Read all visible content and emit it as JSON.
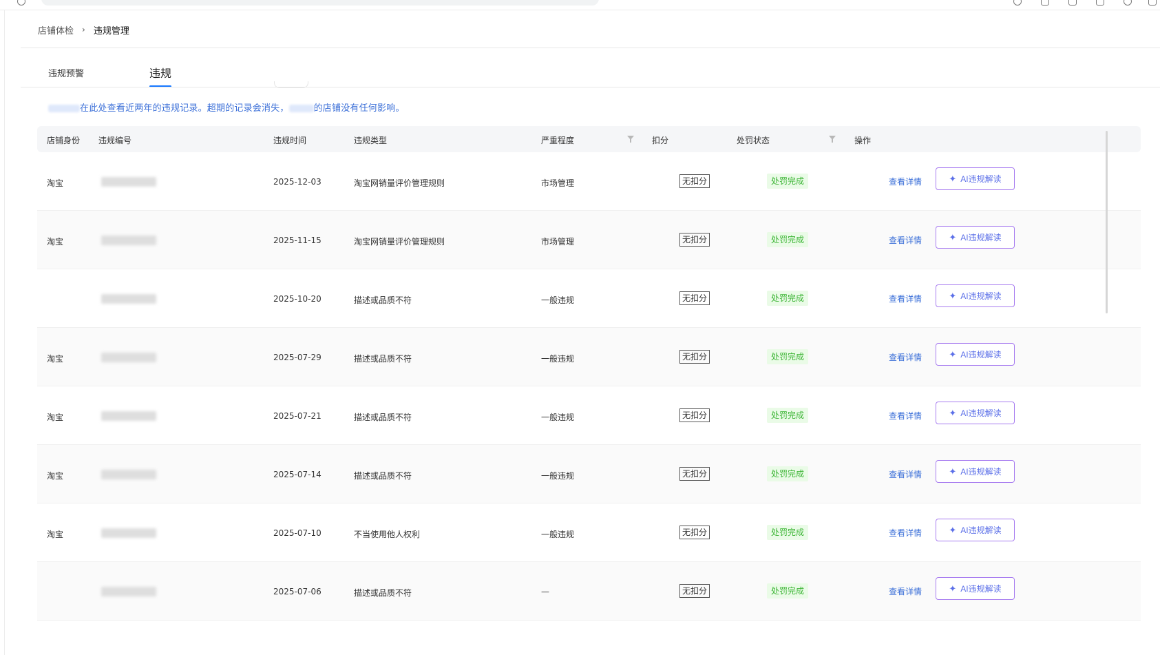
{
  "breadcrumb": {
    "parent": "店铺体检",
    "separator": "›",
    "current": "违规管理"
  },
  "tabs": [
    {
      "label": "违规预警",
      "active": false
    },
    {
      "label": "违规",
      "active": true
    }
  ],
  "notice": {
    "visible_text": "在此处查看近两年的违规记录。超期的记录会消失，",
    "tail_text": "的店铺没有任何影响。"
  },
  "table": {
    "columns": [
      "店铺身份",
      "违规编号",
      "违规时间",
      "违规类型",
      "严重程度",
      "扣分",
      "处罚状态",
      "操作"
    ],
    "rows": [
      {
        "identity": "淘宝",
        "time": "2025-12-03",
        "type": "淘宝网销量评价管理规则",
        "severity": "市场管理",
        "deduct": "无扣分",
        "status": "处罚完成",
        "detail": "查看详情",
        "ai": "AI违规解读"
      },
      {
        "identity": "淘宝",
        "time": "2025-11-15",
        "type": "淘宝网销量评价管理规则",
        "severity": "市场管理",
        "deduct": "无扣分",
        "status": "处罚完成",
        "detail": "查看详情",
        "ai": "AI违规解读"
      },
      {
        "identity": "",
        "time": "2025-10-20",
        "type": "描述或品质不符",
        "severity": "一般违规",
        "deduct": "无扣分",
        "status": "处罚完成",
        "detail": "查看详情",
        "ai": "AI违规解读"
      },
      {
        "identity": "淘宝",
        "time": "2025-07-29",
        "type": "描述或品质不符",
        "severity": "一般违规",
        "deduct": "无扣分",
        "status": "处罚完成",
        "detail": "查看详情",
        "ai": "AI违规解读"
      },
      {
        "identity": "淘宝",
        "time": "2025-07-21",
        "type": "描述或品质不符",
        "severity": "一般违规",
        "deduct": "无扣分",
        "status": "处罚完成",
        "detail": "查看详情",
        "ai": "AI违规解读"
      },
      {
        "identity": "淘宝",
        "time": "2025-07-14",
        "type": "描述或品质不符",
        "severity": "一般违规",
        "deduct": "无扣分",
        "status": "处罚完成",
        "detail": "查看详情",
        "ai": "AI违规解读"
      },
      {
        "identity": "淘宝",
        "time": "2025-07-10",
        "type": "不当使用他人权利",
        "severity": "一般违规",
        "deduct": "无扣分",
        "status": "处罚完成",
        "detail": "查看详情",
        "ai": "AI违规解读"
      },
      {
        "identity": "",
        "time": "2025-07-06",
        "type": "描述或品质不符",
        "severity": "—",
        "deduct": "无扣分",
        "status": "处罚完成",
        "detail": "查看详情",
        "ai": "AI违规解读"
      }
    ]
  }
}
